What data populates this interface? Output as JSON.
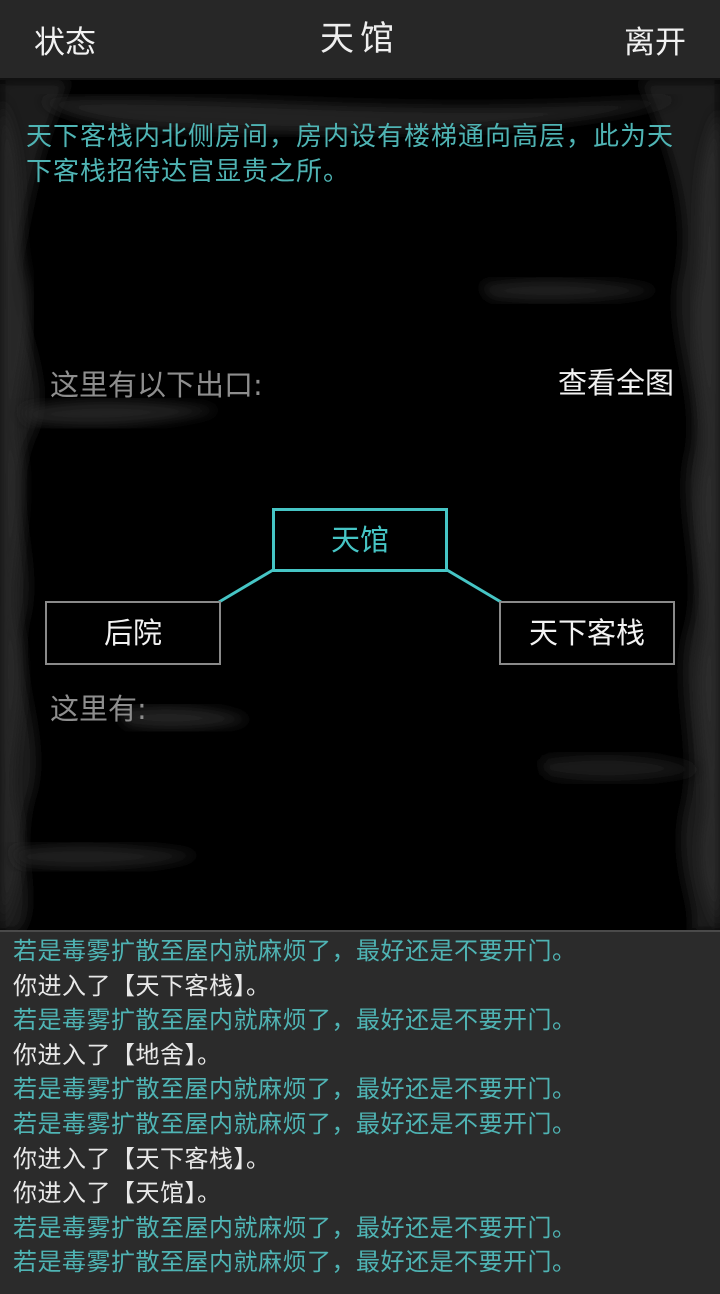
{
  "topbar": {
    "status_label": "状态",
    "title": "天馆",
    "leave_label": "离开"
  },
  "room": {
    "description": "天下客栈内北侧房间，房内设有楼梯通向高层，此为天下客栈招待达官显贵之所。",
    "exits_label": "这里有以下出口:",
    "view_map_label": "查看全图",
    "here_label": "这里有:"
  },
  "map": {
    "current": "天馆",
    "west": "后院",
    "east": "天下客栈"
  },
  "log": [
    {
      "type": "event",
      "text": "若是毒雾扩散至屋内就麻烦了，最好还是不要开门。"
    },
    {
      "type": "enter",
      "text": "你进入了【天下客栈】。"
    },
    {
      "type": "event",
      "text": "若是毒雾扩散至屋内就麻烦了，最好还是不要开门。"
    },
    {
      "type": "enter",
      "text": "你进入了【地舍】。"
    },
    {
      "type": "event",
      "text": "若是毒雾扩散至屋内就麻烦了，最好还是不要开门。"
    },
    {
      "type": "event",
      "text": "若是毒雾扩散至屋内就麻烦了，最好还是不要开门。"
    },
    {
      "type": "enter",
      "text": "你进入了【天下客栈】。"
    },
    {
      "type": "enter",
      "text": "你进入了【天馆】。"
    },
    {
      "type": "event",
      "text": "若是毒雾扩散至屋内就麻烦了，最好还是不要开门。"
    },
    {
      "type": "event",
      "text": "若是毒雾扩散至屋内就麻烦了，最好还是不要开门。"
    }
  ],
  "colors": {
    "accent": "#46c5c5",
    "event_text": "#4fb4b4",
    "log_bg": "#2b2b2b",
    "topbar_bg": "#272727"
  }
}
